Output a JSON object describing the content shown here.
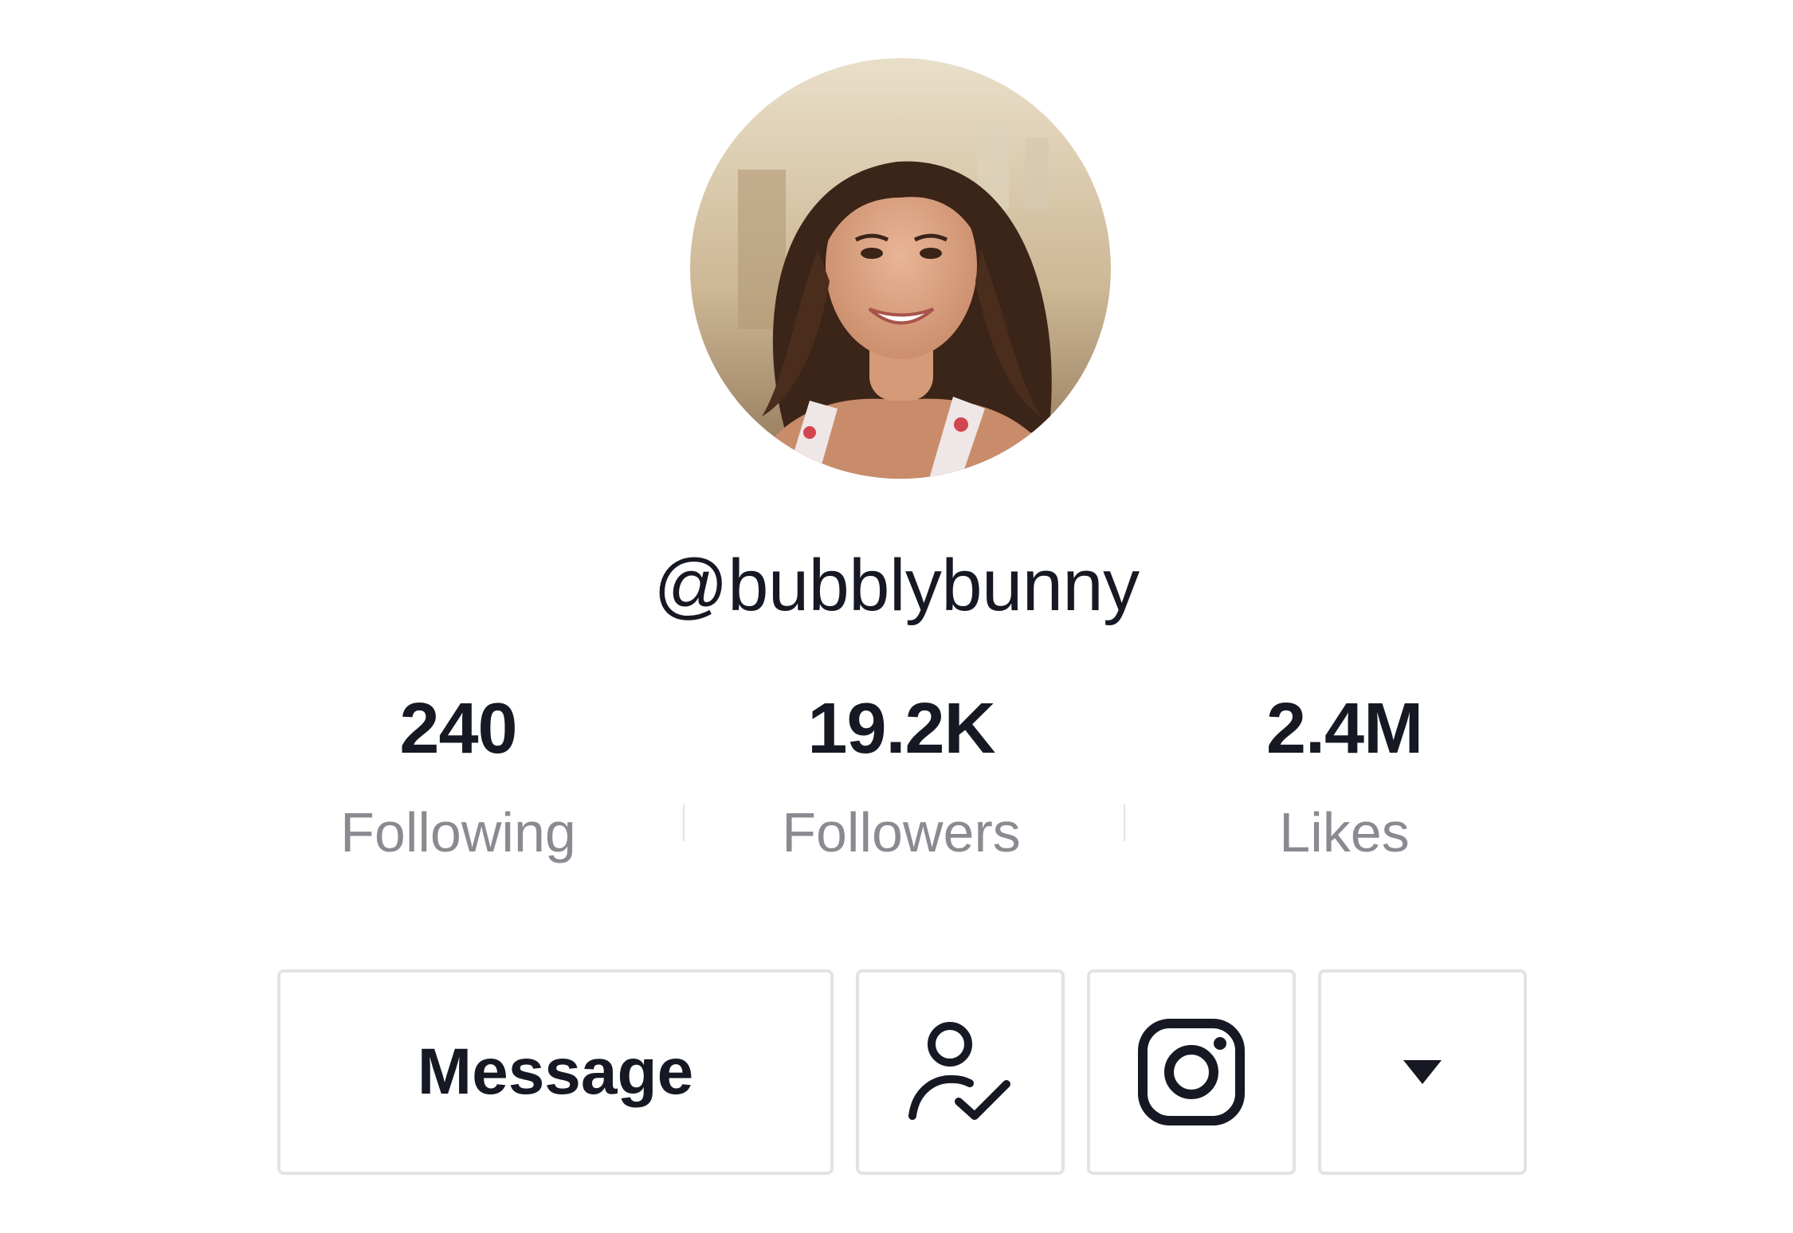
{
  "profile": {
    "avatar_icon": "profile-photo",
    "username": "@bubblybunny"
  },
  "stats": [
    {
      "value": "240",
      "label": "Following"
    },
    {
      "value": "19.2K",
      "label": "Followers"
    },
    {
      "value": "2.4M",
      "label": "Likes"
    }
  ],
  "actions": {
    "message_label": "Message",
    "following_icon": "user-check-icon",
    "instagram_icon": "instagram-icon",
    "more_icon": "caret-down-icon"
  },
  "colors": {
    "text_primary": "#161823",
    "text_secondary": "#8a8b91",
    "border": "#e3e3e4",
    "background": "#ffffff"
  }
}
